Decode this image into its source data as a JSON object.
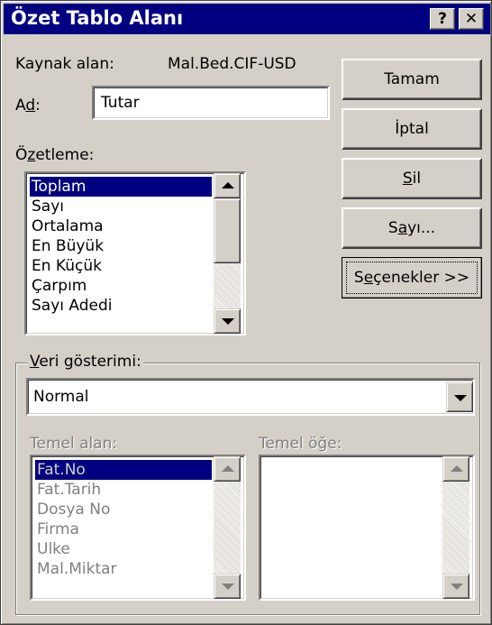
{
  "window": {
    "title": "Özet Tablo Alanı",
    "help_label": "?",
    "close_label": "✕"
  },
  "source": {
    "label_prefix": "Kaynak alan:",
    "value": "Mal.Bed.CIF-USD"
  },
  "name": {
    "label_pre": "A",
    "label_u": "d",
    "label_post": ":",
    "value": "Tutar"
  },
  "summarize": {
    "label_pre": "Ö",
    "label_u": "z",
    "label_post": "etleme:",
    "items": [
      "Toplam",
      "Sayı",
      "Ortalama",
      "En Büyük",
      "En Küçük",
      "Çarpım",
      "Sayı Adedi"
    ],
    "selected": "Toplam"
  },
  "buttons": {
    "ok": "Tamam",
    "cancel": "İptal",
    "delete_u": "S",
    "delete_post": "il",
    "number_pre": "S",
    "number_u": "a",
    "number_post": "yı...",
    "options_pre": "S",
    "options_u": "e",
    "options_post": "çenekler >>"
  },
  "show_data": {
    "group_u": "V",
    "group_post": "eri gösterimi:",
    "value": "Normal",
    "base_field_label": "Temel alan:",
    "base_item_label": "Temel öğe:",
    "base_fields": [
      "Fat.No",
      "Fat.Tarih",
      "Dosya No",
      "Firma",
      "Ulke",
      "Mal.Miktar"
    ],
    "base_fields_selected": "Fat.No"
  }
}
